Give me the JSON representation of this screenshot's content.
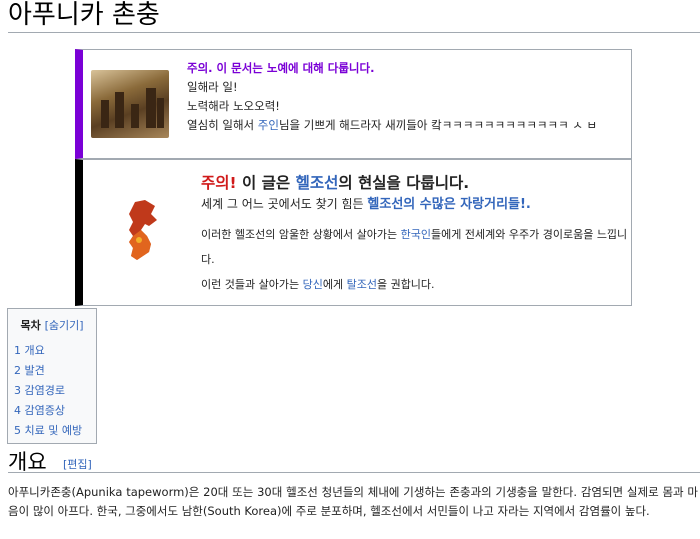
{
  "page": {
    "title": "아푸니카 촌충"
  },
  "notice1": {
    "heading": "주의. 이 문서는 노예에 대해 다룹니다.",
    "line1": "일해라 일!",
    "line2": "노력해라 노오오력!",
    "line3_a": "열심히 일해서 ",
    "line3_link": "주인",
    "line3_b": "님을 기쁘게 해드라자 새끼들아 캌ㅋㅋㅋㅋㅋㅋㅋㅋㅋㅋㅋㅋ ㅅ ㅂ"
  },
  "notice2": {
    "warn": "주의!",
    "title_a": " 이 글은 ",
    "title_link": "헬조선",
    "title_b": "의 현실을 다룹니다.",
    "sub_a": "세계 그 어느 곳에서도 찾기 힘든 ",
    "sub_link": "헬조선의 수많은 자랑거리들!.",
    "body1_a": "이러한 헬조선의 암울한 상황에서 살아가는 ",
    "body1_link": "한국인",
    "body1_b": "들에게 전세계와 우주가 경이로움을 느낍니다.",
    "body2_a": "이런 것들과 살아가는 ",
    "body2_link1": "당신",
    "body2_mid": "에게 ",
    "body2_link2": "탈조선",
    "body2_b": "을 권합니다."
  },
  "toc": {
    "title": "목차",
    "hide": "[숨기기]",
    "items": [
      "1 개요",
      "2 발견",
      "3 감염경로",
      "4 감염증상",
      "5 치료 및 예방"
    ]
  },
  "section": {
    "heading": "개요",
    "edit": "[편집]",
    "paragraph": "아푸니카존충(Apunika tapeworm)은 20대 또는 30대 헬조선 청년들의 체내에 기생하는 존충과의 기생충을 말한다. 감염되면 실제로 몸과 마음이 많이 아프다. 한국, 그중에서도 남한(South Korea)에 주로 분포하며, 헬조선에서 서민들이 나고 자라는 지역에서 감염률이 높다."
  },
  "colors": {
    "accent_purple": "#7a00d6",
    "warn_red": "#d01a1a",
    "link": "#3366bb"
  },
  "icons": {
    "notice1": "slave-painting-image",
    "notice2": "korea-map-image"
  }
}
